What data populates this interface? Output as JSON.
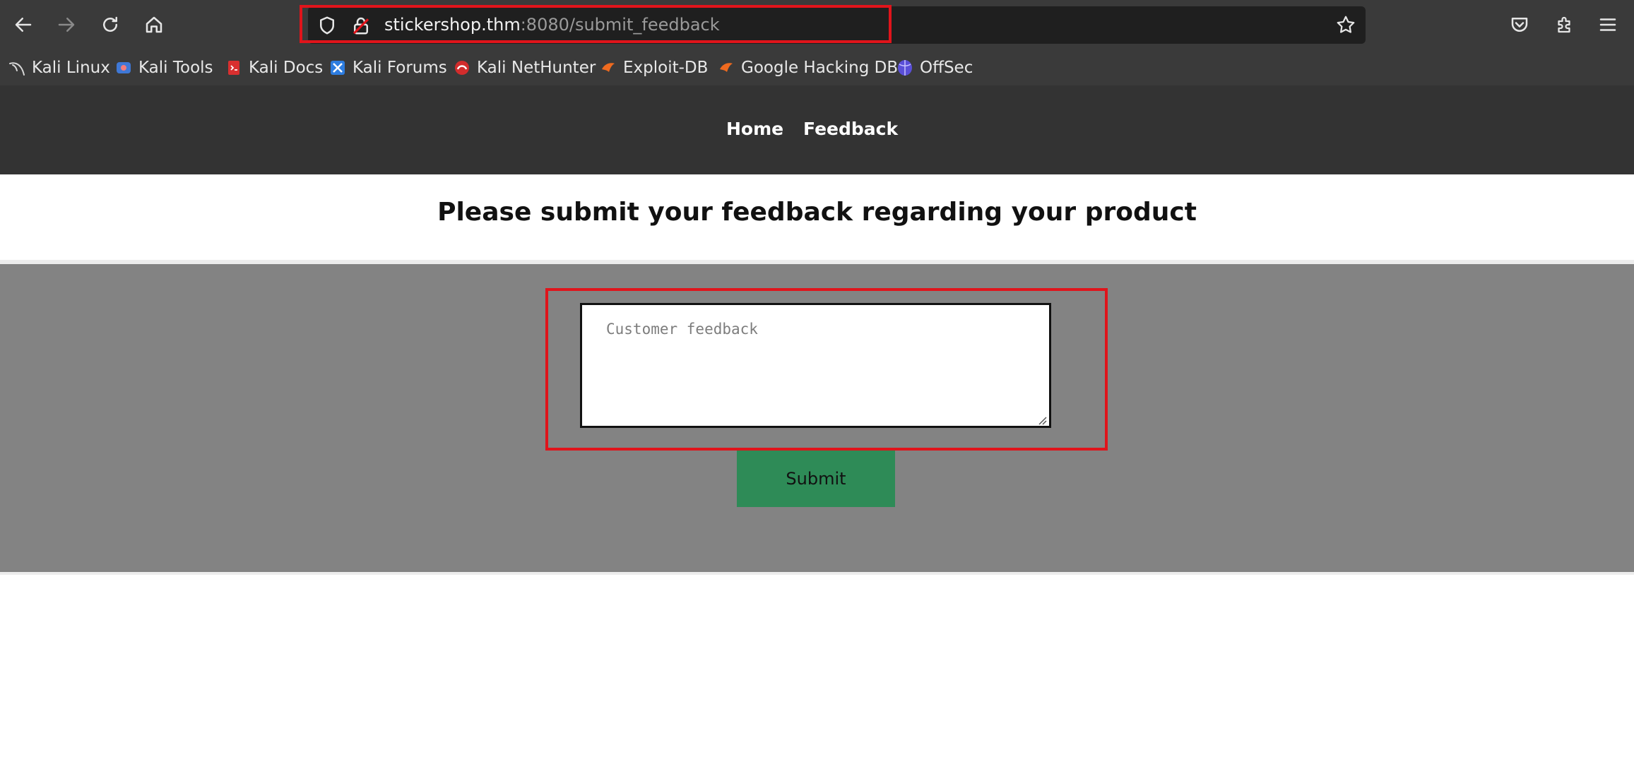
{
  "browser": {
    "url_host": "stickershop.thm",
    "url_rest": ":8080/submit_feedback",
    "bookmarks": [
      {
        "label": "Kali Linux",
        "icon": "kali-dragon-icon"
      },
      {
        "label": "Kali Tools",
        "icon": "kali-tools-icon"
      },
      {
        "label": "Kali Docs",
        "icon": "kali-docs-icon"
      },
      {
        "label": "Kali Forums",
        "icon": "kali-forums-icon"
      },
      {
        "label": "Kali NetHunter",
        "icon": "kali-nethunter-icon"
      },
      {
        "label": "Exploit-DB",
        "icon": "exploit-db-icon"
      },
      {
        "label": "Google Hacking DB",
        "icon": "ghdb-icon"
      },
      {
        "label": "OffSec",
        "icon": "offsec-icon"
      }
    ]
  },
  "site": {
    "nav": {
      "home": "Home",
      "feedback": "Feedback"
    },
    "title": "Please submit your feedback regarding your product",
    "form": {
      "placeholder": "Customer feedback",
      "submit_label": "Submit"
    }
  }
}
